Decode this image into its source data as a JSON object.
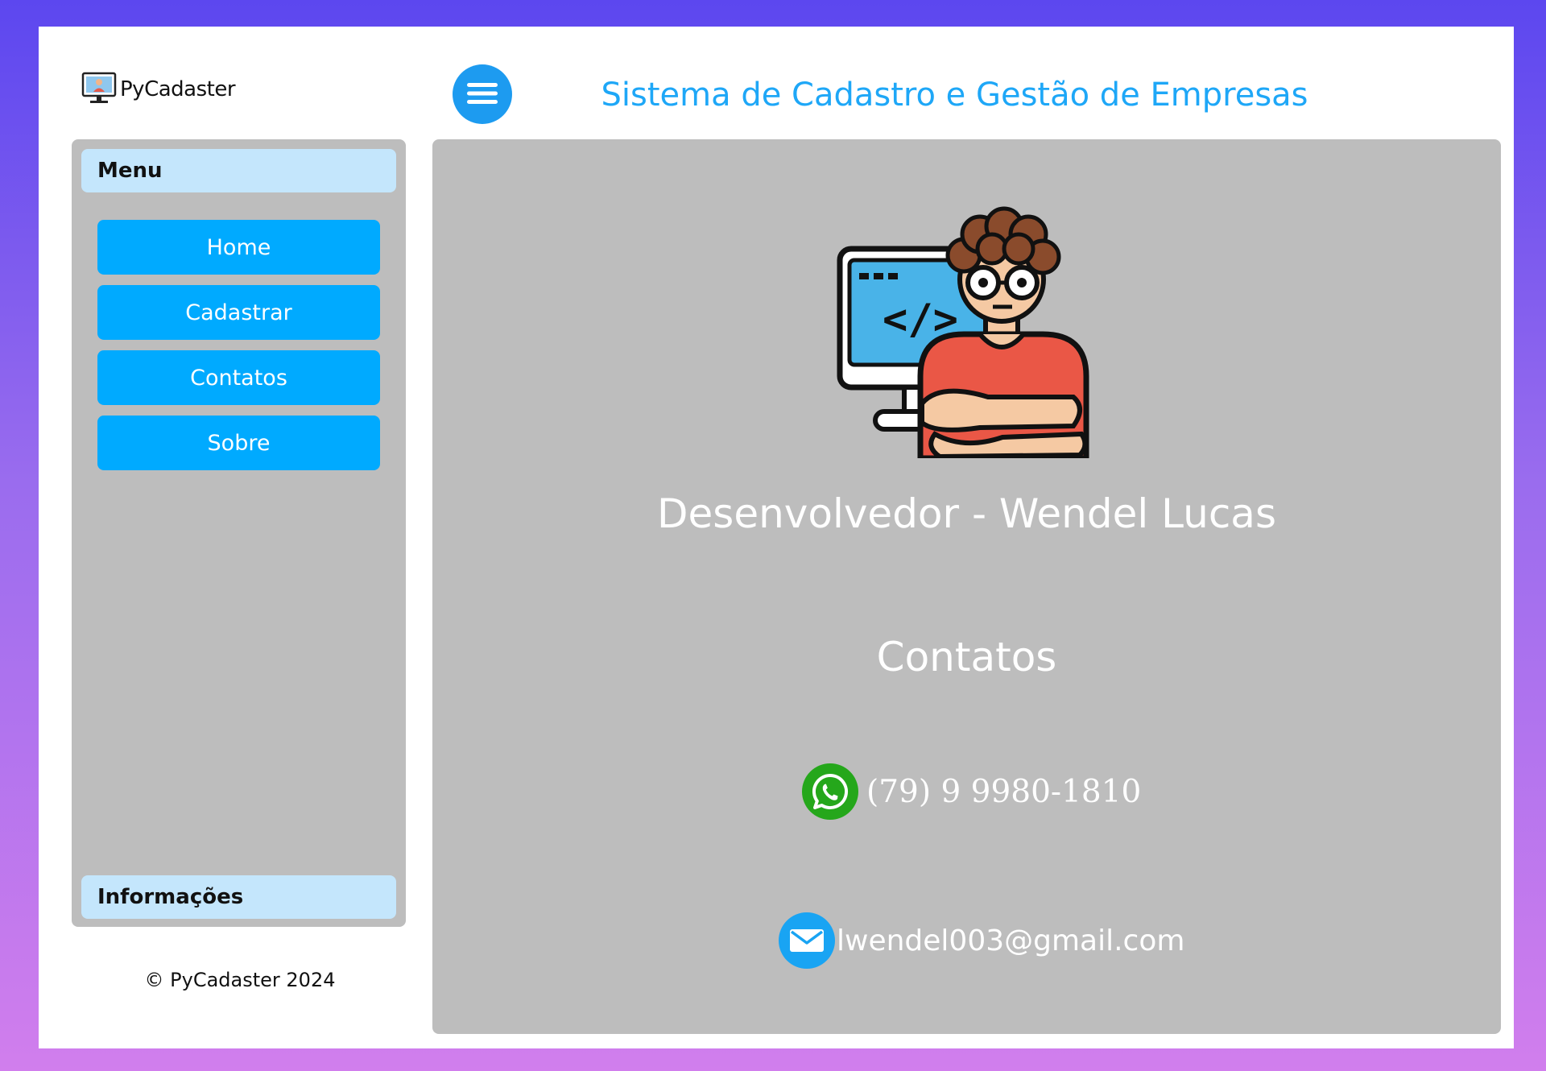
{
  "app": {
    "logo_text": "PyCadaster",
    "title": "Sistema de Cadastro e Gestão de Empresas"
  },
  "sidebar": {
    "menu_header": "Menu",
    "items": [
      {
        "label": "Home"
      },
      {
        "label": "Cadastrar"
      },
      {
        "label": "Contatos"
      },
      {
        "label": "Sobre"
      }
    ],
    "info_header": "Informações",
    "footer": "© PyCadaster 2024"
  },
  "main": {
    "developer": "Desenvolvedor - Wendel Lucas",
    "contacts_title": "Contatos",
    "phone": "(79) 9 9980-1810",
    "email": "lwendel003@gmail.com"
  },
  "colors": {
    "accent": "#00aaff",
    "title": "#1ea7f7",
    "panel": "#bdbdbd",
    "section_header": "#c4e6fc",
    "whatsapp": "#25a71b"
  },
  "icons": [
    "monitor-logo-icon",
    "hamburger-menu-icon",
    "developer-avatar-icon",
    "whatsapp-icon",
    "email-icon"
  ]
}
